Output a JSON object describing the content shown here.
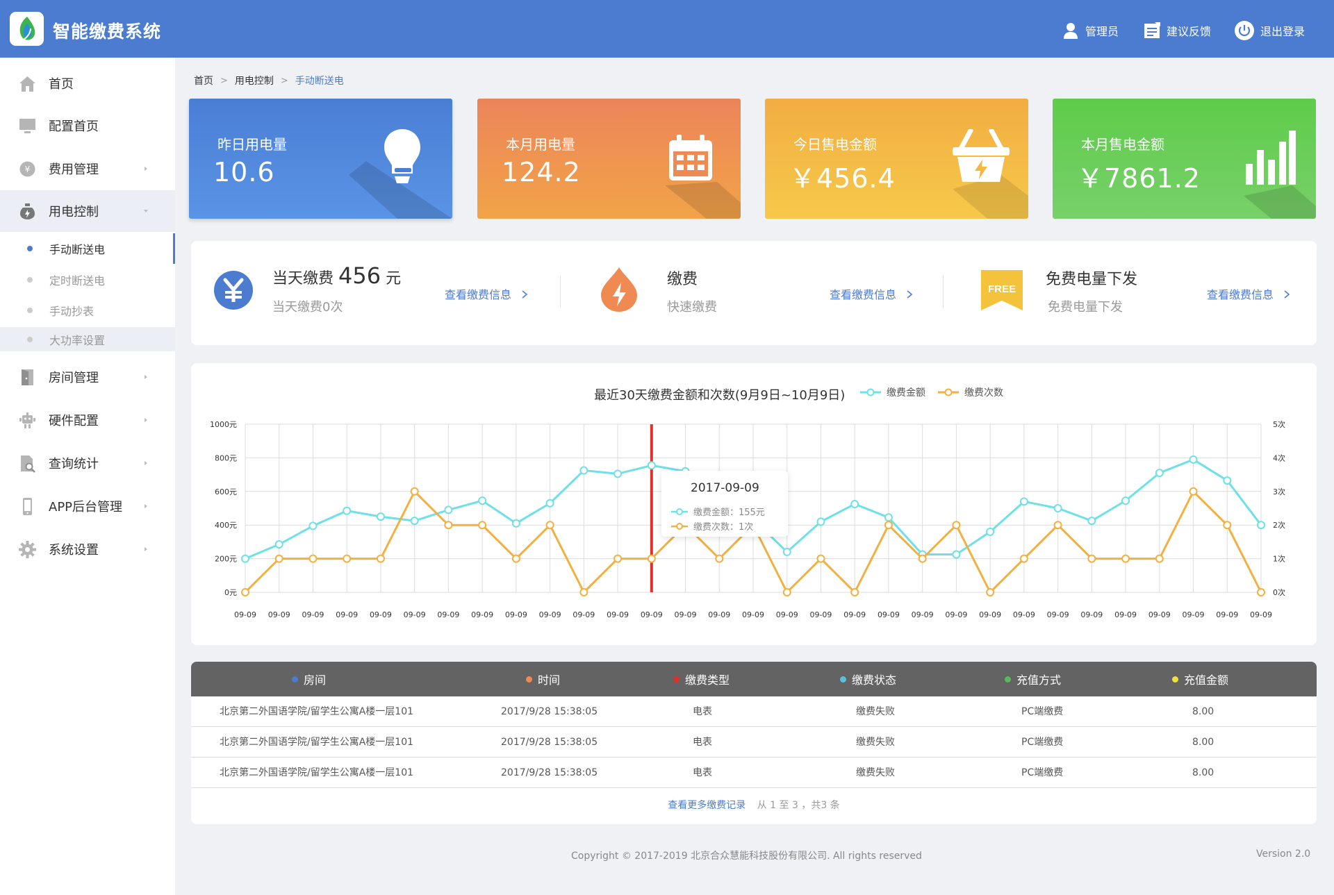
{
  "header": {
    "app_title": "智能缴费系统",
    "user_label": "管理员",
    "feedback_label": "建议反馈",
    "logout_label": "退出登录"
  },
  "sidebar": {
    "items": [
      {
        "label": "首页",
        "icon": "home-icon"
      },
      {
        "label": "配置首页",
        "icon": "monitor-icon"
      },
      {
        "label": "费用管理",
        "icon": "yen-coin-icon"
      },
      {
        "label": "用电控制",
        "icon": "power-bottle-icon"
      },
      {
        "label": "房间管理",
        "icon": "door-icon"
      },
      {
        "label": "硬件配置",
        "icon": "robot-icon"
      },
      {
        "label": "查询统计",
        "icon": "document-search-icon"
      },
      {
        "label": "APP后台管理",
        "icon": "phone-icon"
      },
      {
        "label": "系统设置",
        "icon": "gear-icon"
      }
    ],
    "sub_items": [
      {
        "label": "手动断送电"
      },
      {
        "label": "定时断送电"
      },
      {
        "label": "手动抄表"
      },
      {
        "label": "大功率设置"
      }
    ]
  },
  "breadcrumb": {
    "items": [
      "首页",
      "用电控制",
      "手动断送电"
    ],
    "separator": ">"
  },
  "stats": [
    {
      "label": "昨日用电量",
      "value": "10.6",
      "icon": "lightbulb-icon",
      "color": "#4b7ccf"
    },
    {
      "label": "本月用电量",
      "value": "124.2",
      "icon": "calendar-icon",
      "color": "#ee8a52"
    },
    {
      "label": "今日售电金额",
      "value": "￥456.4",
      "icon": "basket-icon",
      "color": "#f4b942"
    },
    {
      "label": "本月售电金额",
      "value": "￥7861.2",
      "icon": "bar-chart-icon",
      "color": "#62c95a"
    }
  ],
  "info": [
    {
      "title_prefix": "当天缴费",
      "title_value": "456",
      "title_unit": "元",
      "subtitle": "当天缴费0次",
      "link": "查看缴费信息",
      "icon": "yen-circle-icon"
    },
    {
      "title": "缴费",
      "subtitle": "快速缴费",
      "link": "查看缴费信息",
      "icon": "lightning-drop-icon"
    },
    {
      "title": "免费电量下发",
      "subtitle": "免费电量下发",
      "link": "查看缴费信息",
      "icon": "free-ribbon-icon",
      "badge": "FREE"
    }
  ],
  "chart_data": {
    "type": "line",
    "title": "最近30天缴费金额和次数(9月9日~10月9日)",
    "categories": [
      "09-09",
      "09-09",
      "09-09",
      "09-09",
      "09-09",
      "09-09",
      "09-09",
      "09-09",
      "09-09",
      "09-09",
      "09-09",
      "09-09",
      "09-09",
      "09-09",
      "09-09",
      "09-09",
      "09-09",
      "09-09",
      "09-09",
      "09-09",
      "09-09",
      "09-09",
      "09-09",
      "09-09",
      "09-09",
      "09-09",
      "09-09",
      "09-09",
      "09-09",
      "09-09",
      "09-09"
    ],
    "y_left_ticks": [
      "0元",
      "200元",
      "400元",
      "600元",
      "800元",
      "1000元"
    ],
    "y_right_ticks": [
      "0次",
      "1次",
      "2次",
      "3次",
      "4次",
      "5次"
    ],
    "ylim_left": [
      0,
      1000
    ],
    "ylim_right": [
      0,
      5
    ],
    "series": [
      {
        "name": "缴费金额",
        "axis": "left",
        "color": "#6ee0e8",
        "values": [
          200,
          285,
          395,
          485,
          450,
          425,
          490,
          545,
          410,
          530,
          725,
          705,
          755,
          720,
          625,
          435,
          240,
          420,
          525,
          445,
          225,
          225,
          360,
          540,
          500,
          425,
          545,
          710,
          790,
          665,
          400
        ]
      },
      {
        "name": "缴费次数",
        "axis": "right",
        "color": "#f2b040",
        "values": [
          0,
          1,
          1,
          1,
          1,
          3,
          2,
          2,
          1,
          2,
          0,
          1,
          1,
          2,
          1,
          2,
          0,
          1,
          0,
          2,
          1,
          2,
          0,
          1,
          2,
          1,
          1,
          1,
          3,
          2,
          0
        ]
      }
    ],
    "highlight_index": 12,
    "highlight_color": "#e0302c",
    "tooltip": {
      "date": "2017-09-09",
      "amount_label": "缴费金额：155元",
      "count_label": "缴费次数：1次"
    }
  },
  "table": {
    "headers": [
      {
        "label": "房间",
        "dot": "#4b7ccf"
      },
      {
        "label": "时间",
        "dot": "#ee8a52"
      },
      {
        "label": "缴费类型",
        "dot": "#e0302c"
      },
      {
        "label": "缴费状态",
        "dot": "#5bc0de"
      },
      {
        "label": "充值方式",
        "dot": "#5cb85c"
      },
      {
        "label": "充值金额",
        "dot": "#f0e040"
      }
    ],
    "rows": [
      [
        "北京第二外国语学院/留学生公寓A楼一层101",
        "2017/9/28 15:38:05",
        "电表",
        "缴费失败",
        "PC端缴费",
        "8.00"
      ],
      [
        "北京第二外国语学院/留学生公寓A楼一层101",
        "2017/9/28 15:38:05",
        "电表",
        "缴费失败",
        "PC端缴费",
        "8.00"
      ],
      [
        "北京第二外国语学院/留学生公寓A楼一层101",
        "2017/9/28 15:38:05",
        "电表",
        "缴费失败",
        "PC端缴费",
        "8.00"
      ]
    ],
    "more_link": "查看更多缴费记录",
    "pagination": "从 1 至 3 ，共3 条"
  },
  "footer": {
    "copyright": "Copyright © 2017-2019 北京合众慧能科技股份有限公司. All rights reserved",
    "version": "Version 2.0"
  }
}
